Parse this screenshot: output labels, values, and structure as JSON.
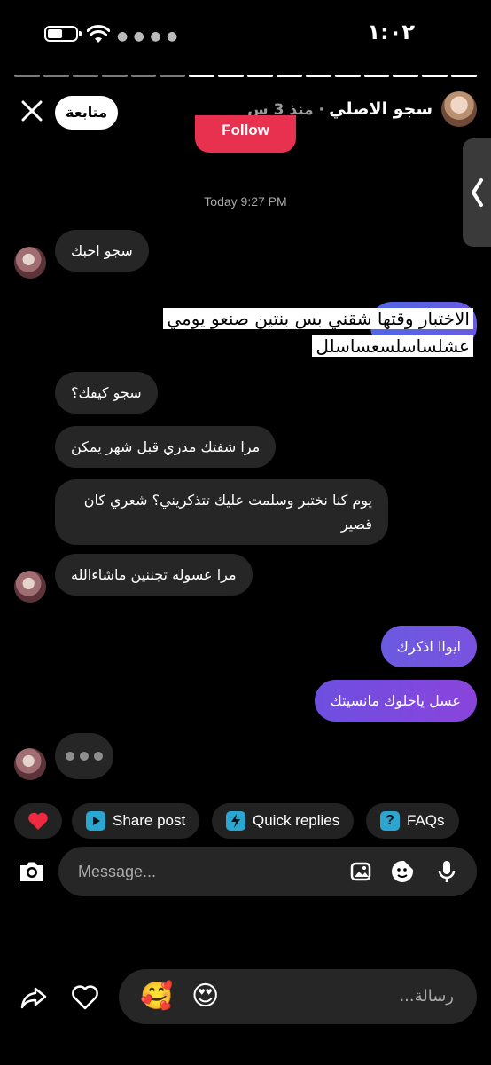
{
  "status_bar": {
    "time": "١:٠٢"
  },
  "story": {
    "segments_total": 16,
    "segments_viewed": 6
  },
  "header": {
    "name": "سجو الاصلي",
    "time_ago": "· منذ 3 س",
    "follow_label": "متابعة"
  },
  "chat": {
    "follow_button": "Follow",
    "timestamp": "Today 9:27 PM",
    "messages": [
      {
        "dir": "in",
        "text": "سجو احبك"
      },
      {
        "dir": "overlay",
        "text": "الاختبار وقتها شقني بس بنتين صنعو يومي عشلساسلسعساسلل"
      },
      {
        "dir": "in",
        "text": "سجو كيفك؟"
      },
      {
        "dir": "in",
        "text": "مرا شفتك مدري قبل شهر يمكن"
      },
      {
        "dir": "in",
        "text": "يوم كنا نختبر وسلمت عليك تتذكريني؟ شعري كان قصير"
      },
      {
        "dir": "in",
        "text": "مرا عسوله تجننين ماشاءالله"
      },
      {
        "dir": "out",
        "text": "ايواا اذكرك"
      },
      {
        "dir": "out",
        "text": "عسل ياحلوك مانسيتك"
      }
    ]
  },
  "quick_actions": {
    "heart": "heart-icon",
    "share_post": "Share post",
    "quick_replies": "Quick replies",
    "faqs": "FAQs"
  },
  "composer": {
    "placeholder": "Message..."
  },
  "story_reply": {
    "placeholder": "رسالة...",
    "emojis": [
      "🥰",
      "😍"
    ]
  },
  "colors": {
    "background": "#000000",
    "incoming_bubble": "#262626",
    "outgoing_gradient_start": "#5b51d8",
    "outgoing_gradient_end": "#833ab4",
    "follow_button": "#e8304f",
    "chip_icon_blue": "#2aa6d1"
  }
}
